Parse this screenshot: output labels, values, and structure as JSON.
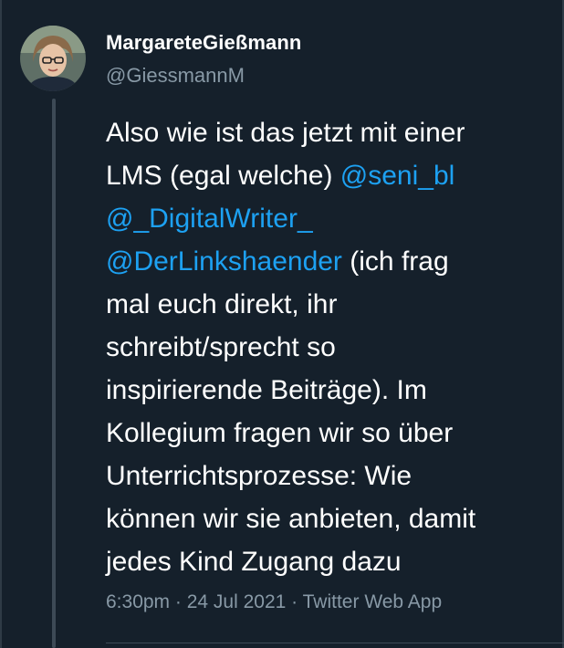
{
  "tweet": {
    "author": {
      "display_name": "MargareteGießmann",
      "handle": "@GiessmannM"
    },
    "lines": [
      [
        {
          "t": "Also wie ist das jetzt mit einer",
          "m": false
        }
      ],
      [
        {
          "t": "LMS (egal welche) ",
          "m": false
        },
        {
          "t": "@seni_bl",
          "m": true
        }
      ],
      [
        {
          "t": "@_DigitalWriter_",
          "m": true
        }
      ],
      [
        {
          "t": "@DerLinkshaender",
          "m": true
        },
        {
          "t": " (ich frag",
          "m": false
        }
      ],
      [
        {
          "t": "mal euch direkt, ihr",
          "m": false
        }
      ],
      [
        {
          "t": "schreibt/sprecht so",
          "m": false
        }
      ],
      [
        {
          "t": "inspirierende Beiträge). Im",
          "m": false
        }
      ],
      [
        {
          "t": "Kollegium fragen wir so über",
          "m": false
        }
      ],
      [
        {
          "t": "Unterrichtsprozesse: Wie",
          "m": false
        }
      ],
      [
        {
          "t": "können wir sie anbieten, damit",
          "m": false
        }
      ],
      [
        {
          "t": "jedes Kind Zugang dazu",
          "m": false
        }
      ]
    ],
    "meta": {
      "time": "6:30pm",
      "date": "24 Jul 2021",
      "source": "Twitter Web App",
      "separator": "·"
    }
  },
  "colors": {
    "background": "#15202b",
    "text": "#ffffff",
    "mention": "#1da1f2",
    "muted": "#8899a6",
    "thread_line": "#3d4a56"
  },
  "icons": {
    "avatar": "user-avatar-photo"
  }
}
